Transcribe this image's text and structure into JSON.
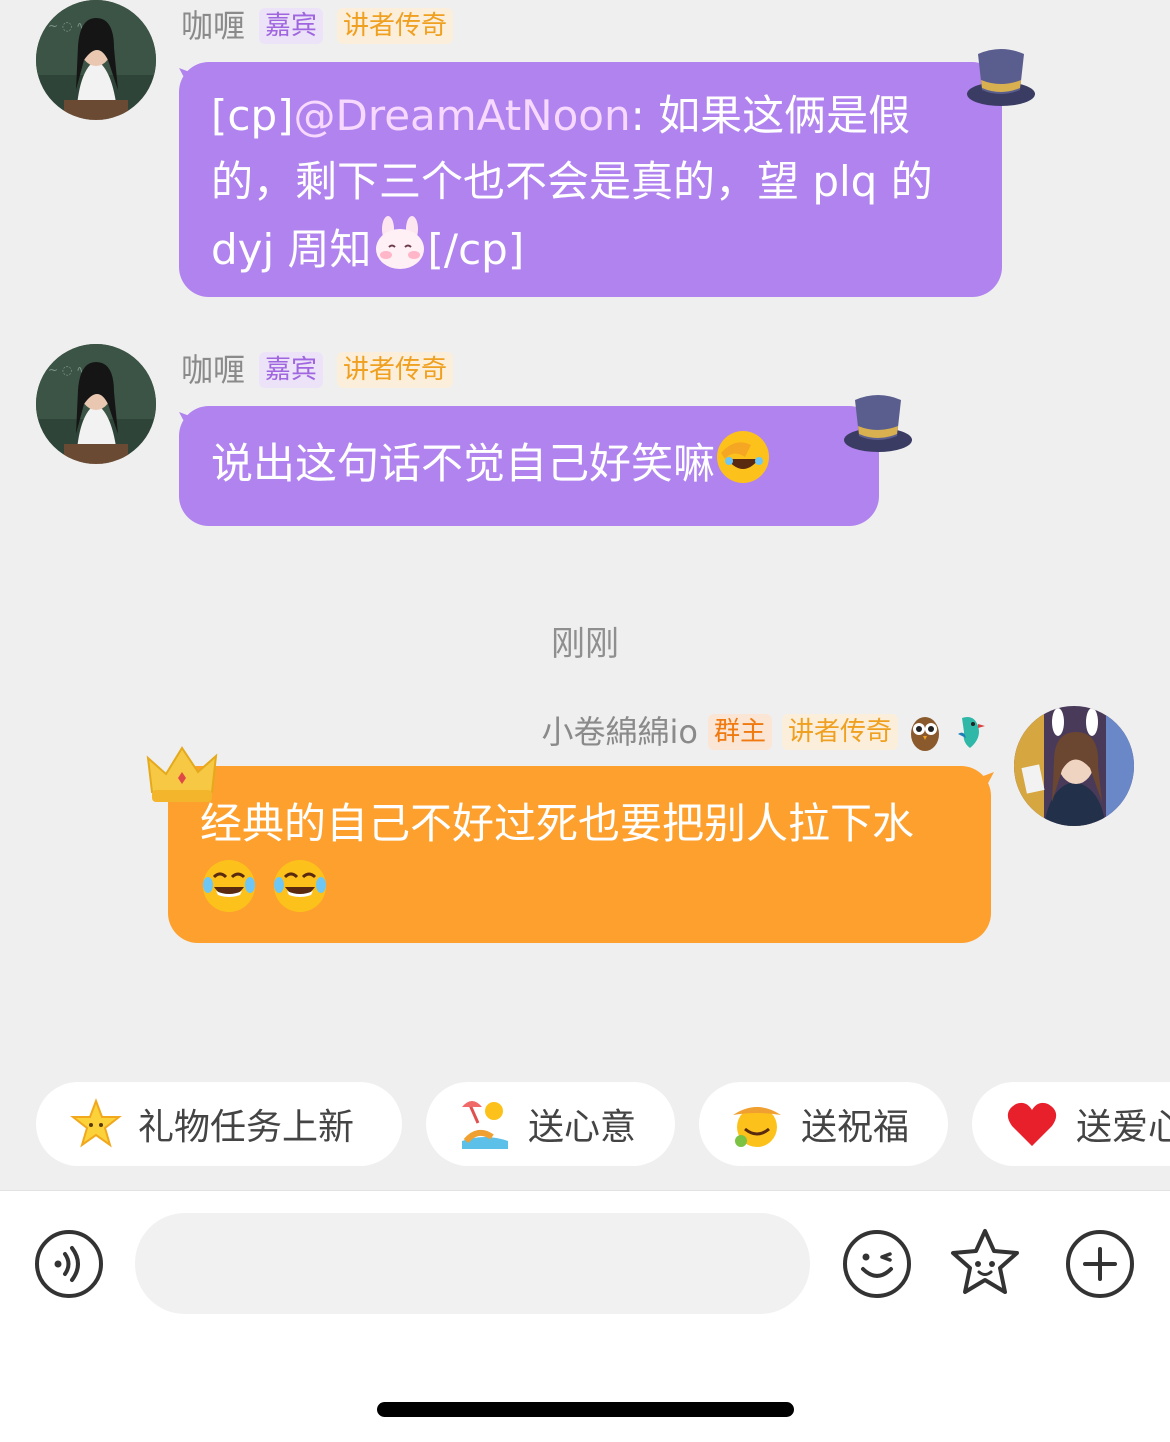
{
  "messages": [
    {
      "sender": "咖喱",
      "badges": [
        "嘉宾",
        "讲者传奇"
      ],
      "text_prefix": "[cp]",
      "mention": "@DreamAtNoon",
      "text_body": ": 如果这俩是假的，剩下三个也不会是真的，望 plq 的 dyj 周知",
      "text_suffix": "[/cp]",
      "emoji": "bunny-face-emoji"
    },
    {
      "sender": "咖喱",
      "badges": [
        "嘉宾",
        "讲者传奇"
      ],
      "text": "说出这句话不觉自己好笑嘛",
      "emoji": "face-palm-laugh-emoji"
    },
    {
      "sender": "小卷綿綿io",
      "badges": [
        "群主",
        "讲者传奇"
      ],
      "text": "经典的自己不好过死也要把别人拉下水",
      "emoji": "tears-of-joy-emoji"
    }
  ],
  "timestamp": "刚刚",
  "quick_chips": [
    {
      "label": "礼物任务上新",
      "icon": "star-icon"
    },
    {
      "label": "送心意",
      "icon": "beach-icon"
    },
    {
      "label": "送祝福",
      "icon": "smiley-hat-icon"
    },
    {
      "label": "送爱心",
      "icon": "heart-icon"
    }
  ],
  "input": {
    "placeholder": ""
  },
  "toolbar": {
    "voice": "voice-icon",
    "emoji": "emoji-icon",
    "sticker": "star-sticker-icon",
    "plus": "plus-icon"
  },
  "colors": {
    "purple_bubble": "#b083ef",
    "orange_bubble": "#fda02e",
    "background": "#efefef"
  }
}
